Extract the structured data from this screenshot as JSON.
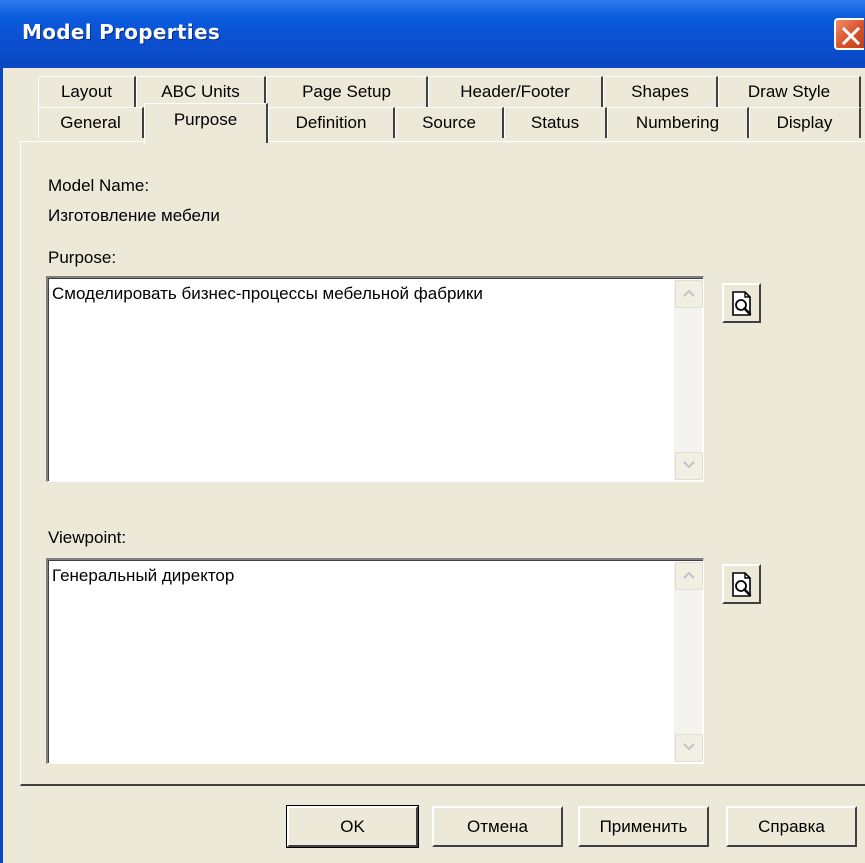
{
  "window": {
    "title": "Model Properties"
  },
  "tabs": {
    "row1": [
      "Layout",
      "ABC Units",
      "Page Setup",
      "Header/Footer",
      "Shapes",
      "Draw Style"
    ],
    "row2": [
      "General",
      "Purpose",
      "Definition",
      "Source",
      "Status",
      "Numbering",
      "Display"
    ],
    "selected": "Purpose"
  },
  "purpose_page": {
    "model_name_label": "Model Name:",
    "model_name_value": "Изготовление мебели",
    "purpose_label": "Purpose:",
    "purpose_value": "Смоделировать бизнес-процессы мебельной фабрики",
    "viewpoint_label": "Viewpoint:",
    "viewpoint_value": "Генеральный директор"
  },
  "buttons": {
    "ok": "OK",
    "cancel": "Отмена",
    "apply": "Применить",
    "help": "Справка"
  },
  "icons": {
    "close": "close-icon",
    "preview": "document-preview-icon",
    "scroll_up": "chevron-up-icon",
    "scroll_down": "chevron-down-icon"
  },
  "colors": {
    "titlebar": "#0A5CDE",
    "dialog_bg": "#ECE9D8",
    "close_button": "#D9522A"
  }
}
